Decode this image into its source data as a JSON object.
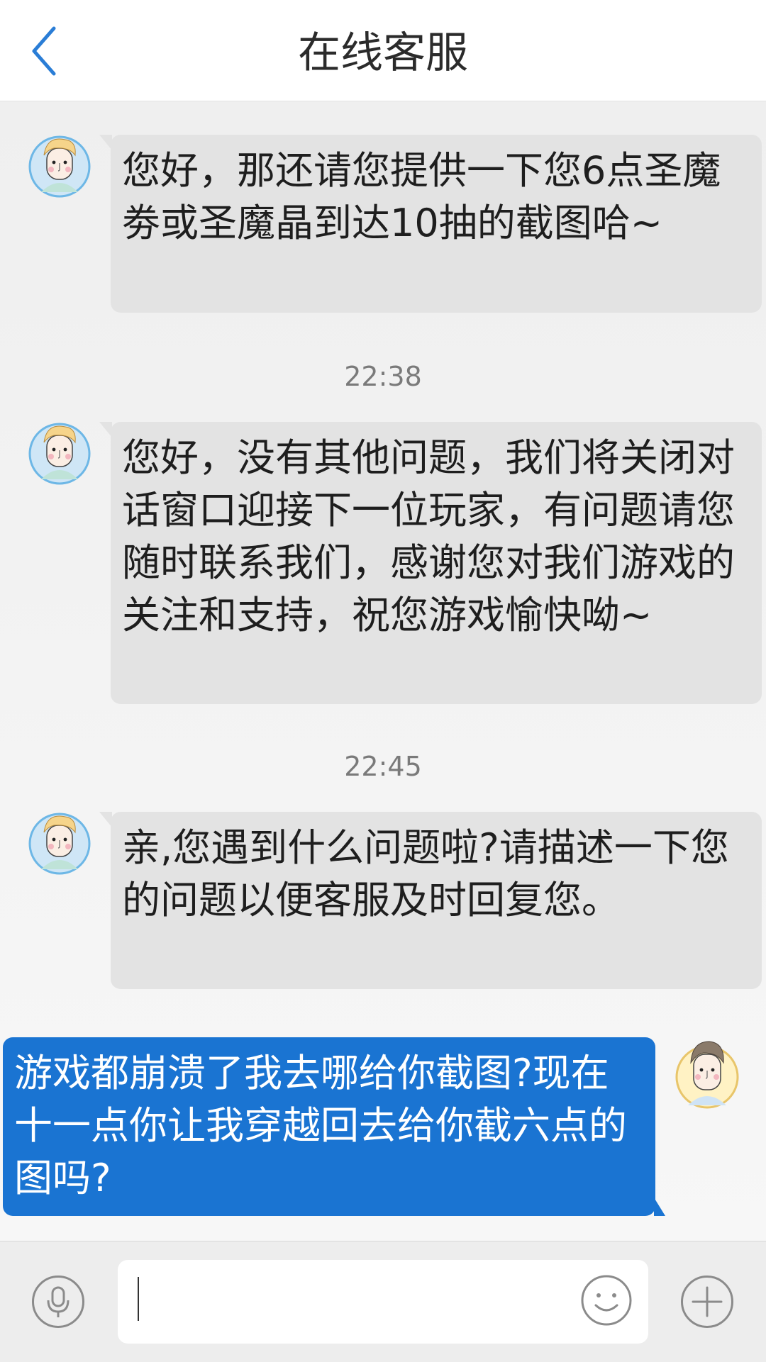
{
  "header": {
    "title": "在线客服"
  },
  "messages": [
    {
      "from": "agent",
      "text": "您好，那还请您提供一下您6点圣魔劵或圣魔晶到达10抽的截图哈~"
    },
    {
      "from": "agent",
      "time": "22:38",
      "text": "您好，没有其他问题，我们将关闭对话窗口迎接下一位玩家，有问题请您随时联系我们，感谢您对我们游戏的关注和支持，祝您游戏愉快呦~"
    },
    {
      "from": "agent",
      "time": "22:45",
      "text": "亲,您遇到什么问题啦?请描述一下您的问题以便客服及时回复您。"
    },
    {
      "from": "user",
      "text": "游戏都崩溃了我去哪给你截图?现在十一点你让我穿越回去给你截六点的图吗?"
    }
  ],
  "input": {
    "value": "",
    "placeholder": ""
  },
  "icons": {
    "back": "chevron-left-icon",
    "voice": "microphone-icon",
    "emoji": "smiley-icon",
    "more": "plus-icon"
  },
  "colors": {
    "accent": "#1a74d2",
    "agent_bubble": "#e3e3e3",
    "user_bubble": "#1a74d2",
    "timestamp": "#7a7a7a"
  }
}
